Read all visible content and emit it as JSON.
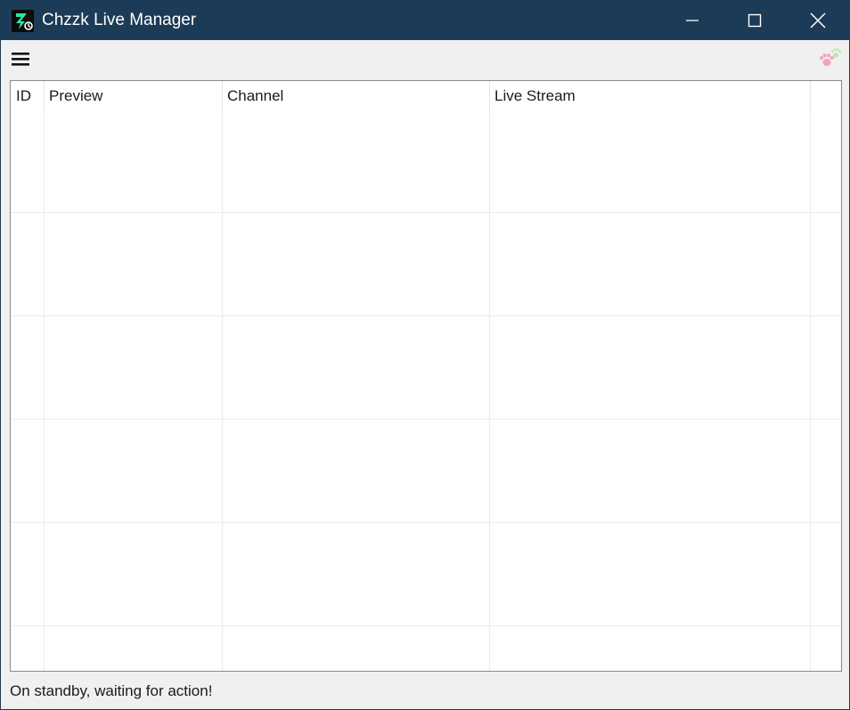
{
  "window": {
    "title": "Chzzk Live Manager",
    "app_icon": "chzzk-app-icon"
  },
  "window_controls": {
    "minimize_icon": "minimize-icon",
    "maximize_icon": "maximize-icon",
    "close_icon": "close-icon"
  },
  "toolbar": {
    "menu_icon": "hamburger-menu-icon",
    "decoration_icon": "paw-prints-icon"
  },
  "table": {
    "columns": [
      "ID",
      "Preview",
      "Channel",
      "Live Stream",
      ""
    ],
    "rows": [
      {
        "id": "",
        "preview": "",
        "channel": "",
        "live_stream": ""
      },
      {
        "id": "",
        "preview": "",
        "channel": "",
        "live_stream": ""
      },
      {
        "id": "",
        "preview": "",
        "channel": "",
        "live_stream": ""
      },
      {
        "id": "",
        "preview": "",
        "channel": "",
        "live_stream": ""
      },
      {
        "id": "",
        "preview": "",
        "channel": "",
        "live_stream": ""
      },
      {
        "id": "",
        "preview": "",
        "channel": "",
        "live_stream": ""
      }
    ]
  },
  "status": {
    "text": "On standby, waiting for action!"
  },
  "colors": {
    "titlebar": "#1c3b57",
    "window_bg": "#f0f0f0",
    "table_bg": "#ffffff",
    "grid_line": "#ececec",
    "paw_pink": "#f3a3b7",
    "paw_green": "#bfe3b0",
    "icon_green": "#2ee59d"
  }
}
